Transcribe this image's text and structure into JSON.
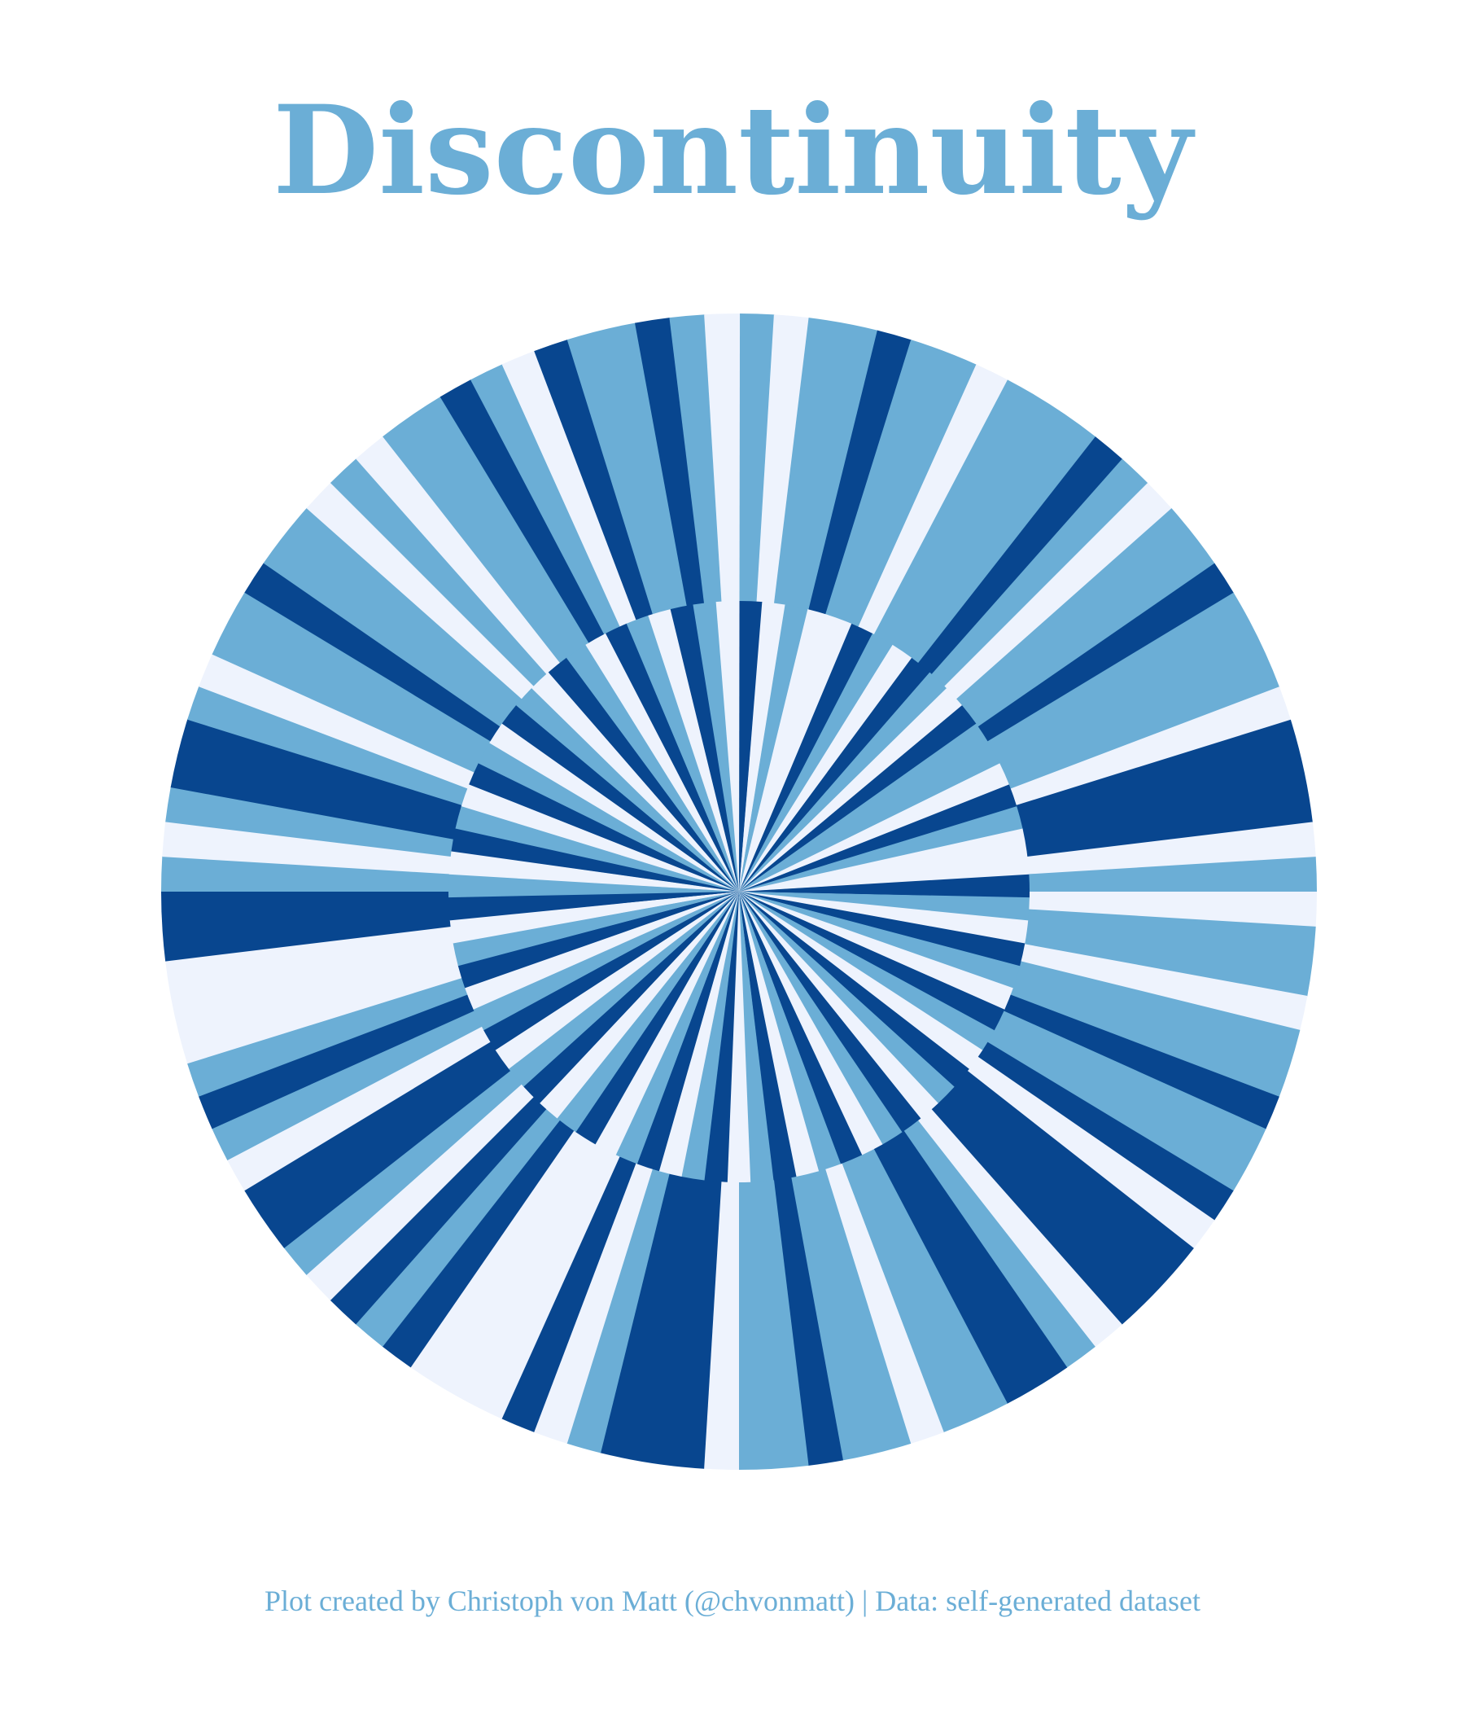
{
  "chart_data": {
    "type": "pie",
    "title": "Discontinuity",
    "caption": "Plot created by Christoph von Matt (@chvonmatt) | Data: self-generated dataset",
    "colors": [
      "#08468f",
      "#6baed6",
      "#eef3fd"
    ],
    "outer_ring": {
      "slices": [
        {
          "value": 1,
          "color": 1
        },
        {
          "value": 1,
          "color": 2
        },
        {
          "value": 2,
          "color": 1
        },
        {
          "value": 1,
          "color": 0
        },
        {
          "value": 2,
          "color": 1
        },
        {
          "value": 1,
          "color": 2
        },
        {
          "value": 3,
          "color": 1
        },
        {
          "value": 1,
          "color": 0
        },
        {
          "value": 1,
          "color": 1
        },
        {
          "value": 1,
          "color": 2
        },
        {
          "value": 2,
          "color": 1
        },
        {
          "value": 1,
          "color": 0
        },
        {
          "value": 3,
          "color": 1
        },
        {
          "value": 1,
          "color": 2
        },
        {
          "value": 3,
          "color": 0
        },
        {
          "value": 1,
          "color": 2
        },
        {
          "value": 1,
          "color": 1
        },
        {
          "value": 1,
          "color": 2
        },
        {
          "value": 2,
          "color": 1
        },
        {
          "value": 1,
          "color": 2
        },
        {
          "value": 2,
          "color": 1
        },
        {
          "value": 1,
          "color": 0
        },
        {
          "value": 2,
          "color": 1
        },
        {
          "value": 1,
          "color": 0
        },
        {
          "value": 1,
          "color": 2
        },
        {
          "value": 3,
          "color": 0
        },
        {
          "value": 1,
          "color": 2
        },
        {
          "value": 1,
          "color": 1
        },
        {
          "value": 2,
          "color": 0
        },
        {
          "value": 2,
          "color": 1
        },
        {
          "value": 1,
          "color": 2
        },
        {
          "value": 2,
          "color": 1
        },
        {
          "value": 1,
          "color": 0
        },
        {
          "value": 2,
          "color": 1
        },
        {
          "value": 1,
          "color": 2
        },
        {
          "value": 3,
          "color": 0
        },
        {
          "value": 1,
          "color": 1
        },
        {
          "value": 1,
          "color": 2
        },
        {
          "value": 1,
          "color": 0
        },
        {
          "value": 3,
          "color": 2
        },
        {
          "value": 1,
          "color": 0
        },
        {
          "value": 1,
          "color": 1
        },
        {
          "value": 1,
          "color": 0
        },
        {
          "value": 1,
          "color": 2
        },
        {
          "value": 1,
          "color": 1
        },
        {
          "value": 2,
          "color": 0
        },
        {
          "value": 1,
          "color": 2
        },
        {
          "value": 1,
          "color": 1
        },
        {
          "value": 1,
          "color": 0
        },
        {
          "value": 1,
          "color": 1
        },
        {
          "value": 3,
          "color": 2
        },
        {
          "value": 2,
          "color": 0
        },
        {
          "value": 1,
          "color": 1
        },
        {
          "value": 1,
          "color": 2
        },
        {
          "value": 1,
          "color": 1
        },
        {
          "value": 2,
          "color": 0
        },
        {
          "value": 1,
          "color": 1
        },
        {
          "value": 1,
          "color": 2
        },
        {
          "value": 2,
          "color": 1
        },
        {
          "value": 1,
          "color": 0
        },
        {
          "value": 2,
          "color": 1
        },
        {
          "value": 1,
          "color": 2
        },
        {
          "value": 1,
          "color": 1
        },
        {
          "value": 1,
          "color": 2
        },
        {
          "value": 2,
          "color": 1
        },
        {
          "value": 1,
          "color": 0
        },
        {
          "value": 1,
          "color": 1
        },
        {
          "value": 1,
          "color": 2
        },
        {
          "value": 1,
          "color": 0
        },
        {
          "value": 2,
          "color": 1
        },
        {
          "value": 1,
          "color": 0
        },
        {
          "value": 1,
          "color": 1
        },
        {
          "value": 1,
          "color": 2
        }
      ]
    },
    "inner_ring": {
      "slices": [
        {
          "value": 1,
          "color": 0
        },
        {
          "value": 1,
          "color": 2
        },
        {
          "value": 1,
          "color": 1
        },
        {
          "value": 2,
          "color": 2
        },
        {
          "value": 1,
          "color": 0
        },
        {
          "value": 1,
          "color": 1
        },
        {
          "value": 1,
          "color": 2
        },
        {
          "value": 1,
          "color": 0
        },
        {
          "value": 1,
          "color": 1
        },
        {
          "value": 1,
          "color": 2
        },
        {
          "value": 1,
          "color": 0
        },
        {
          "value": 2,
          "color": 1
        },
        {
          "value": 1,
          "color": 2
        },
        {
          "value": 1,
          "color": 0
        },
        {
          "value": 1,
          "color": 1
        },
        {
          "value": 2,
          "color": 2
        },
        {
          "value": 1,
          "color": 0
        },
        {
          "value": 1,
          "color": 1
        },
        {
          "value": 1,
          "color": 2
        },
        {
          "value": 1,
          "color": 0
        },
        {
          "value": 1,
          "color": 1
        },
        {
          "value": 1,
          "color": 2
        },
        {
          "value": 1,
          "color": 0
        },
        {
          "value": 1,
          "color": 1
        },
        {
          "value": 1,
          "color": 2
        },
        {
          "value": 1,
          "color": 0
        },
        {
          "value": 1,
          "color": 1
        },
        {
          "value": 1,
          "color": 2
        },
        {
          "value": 1,
          "color": 0
        },
        {
          "value": 1,
          "color": 1
        },
        {
          "value": 1,
          "color": 2
        },
        {
          "value": 1,
          "color": 0
        },
        {
          "value": 1,
          "color": 1
        },
        {
          "value": 1,
          "color": 2
        },
        {
          "value": 1,
          "color": 0
        },
        {
          "value": 1,
          "color": 1
        },
        {
          "value": 1,
          "color": 2
        },
        {
          "value": 1,
          "color": 0
        },
        {
          "value": 1,
          "color": 1
        },
        {
          "value": 1,
          "color": 2
        },
        {
          "value": 1,
          "color": 0
        },
        {
          "value": 1,
          "color": 1
        },
        {
          "value": 1,
          "color": 2
        },
        {
          "value": 1,
          "color": 0
        },
        {
          "value": 1,
          "color": 1
        },
        {
          "value": 1,
          "color": 2
        },
        {
          "value": 1,
          "color": 0
        },
        {
          "value": 1,
          "color": 1
        },
        {
          "value": 1,
          "color": 2
        },
        {
          "value": 1,
          "color": 0
        },
        {
          "value": 1,
          "color": 1
        },
        {
          "value": 1,
          "color": 2
        },
        {
          "value": 1,
          "color": 0
        },
        {
          "value": 1,
          "color": 1
        },
        {
          "value": 1,
          "color": 2
        },
        {
          "value": 1,
          "color": 0
        },
        {
          "value": 1,
          "color": 1
        },
        {
          "value": 1,
          "color": 2
        },
        {
          "value": 1,
          "color": 0
        },
        {
          "value": 1,
          "color": 1
        },
        {
          "value": 1,
          "color": 2
        },
        {
          "value": 1,
          "color": 0
        },
        {
          "value": 1,
          "color": 1
        },
        {
          "value": 1,
          "color": 2
        },
        {
          "value": 1,
          "color": 0
        },
        {
          "value": 1,
          "color": 1
        },
        {
          "value": 1,
          "color": 2
        },
        {
          "value": 1,
          "color": 0
        },
        {
          "value": 1,
          "color": 1
        },
        {
          "value": 1,
          "color": 2
        },
        {
          "value": 1,
          "color": 0
        },
        {
          "value": 1,
          "color": 1
        },
        {
          "value": 1,
          "color": 2
        },
        {
          "value": 1,
          "color": 0
        },
        {
          "value": 1,
          "color": 1
        },
        {
          "value": 1,
          "color": 2
        }
      ]
    }
  }
}
